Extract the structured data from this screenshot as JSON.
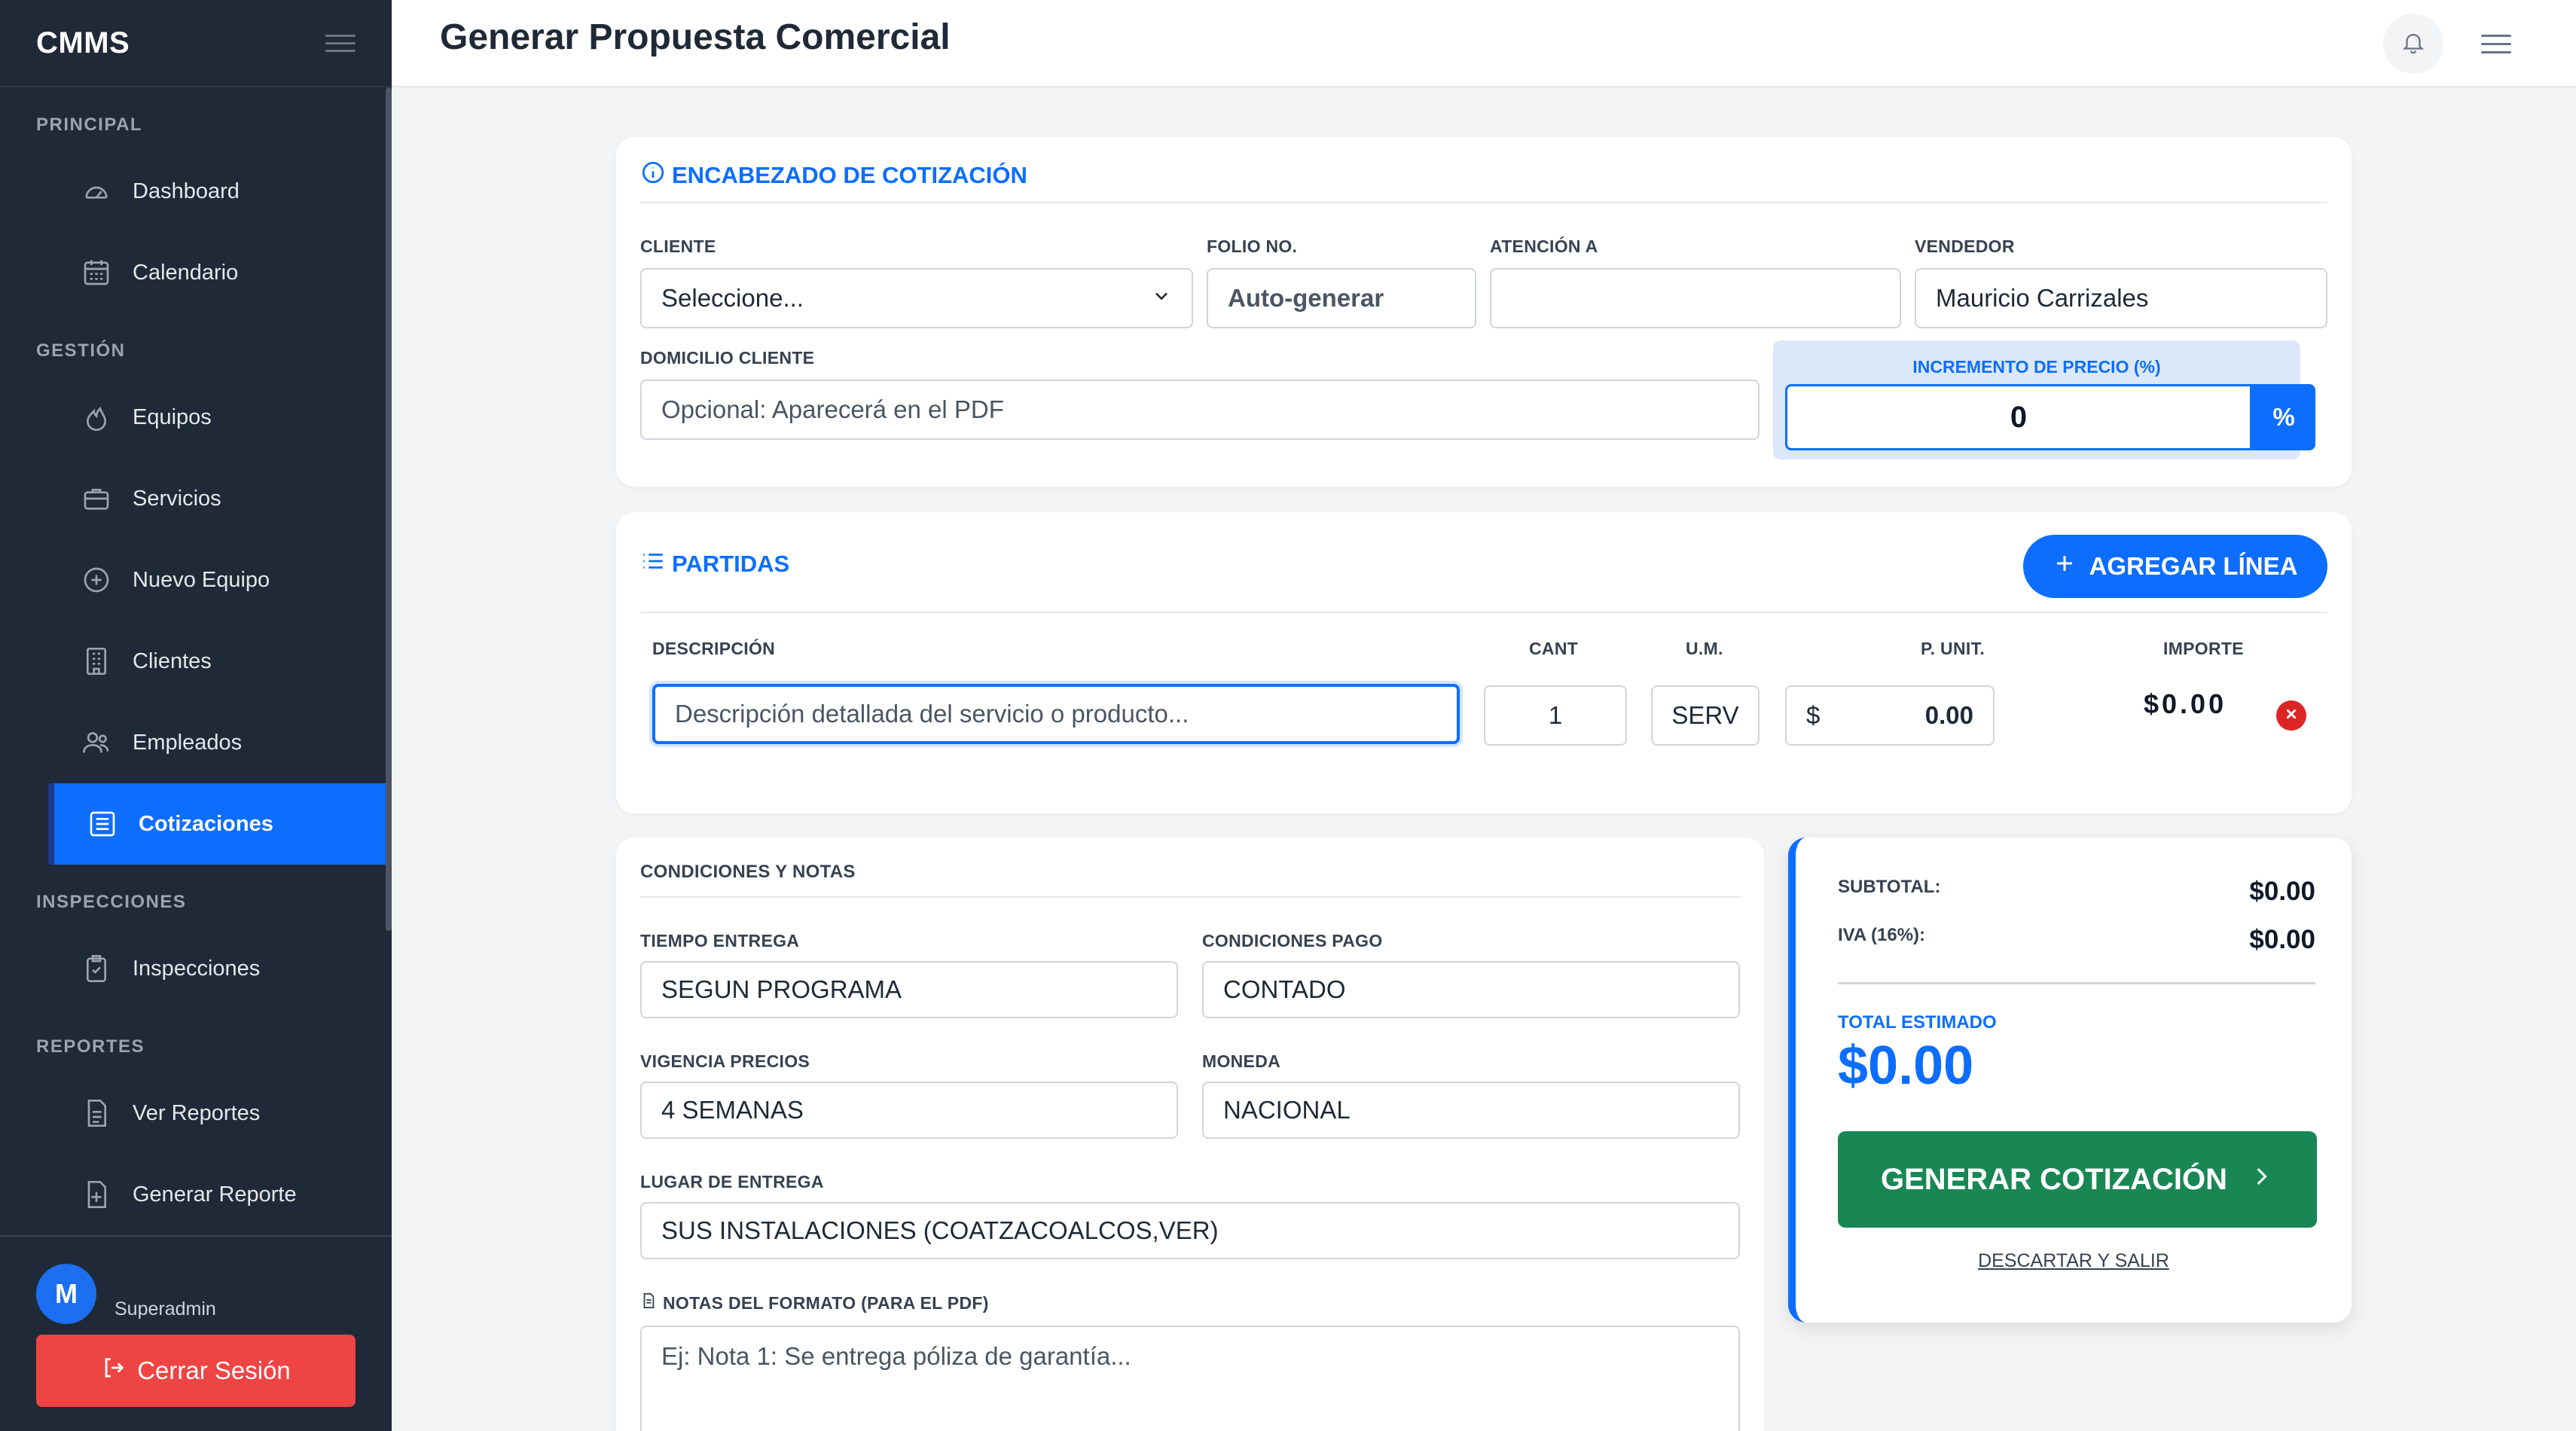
{
  "app": {
    "brand": "CMMS"
  },
  "sidebar": {
    "sections": {
      "principal": "PRINCIPAL",
      "gestion": "GESTIÓN",
      "inspecciones": "INSPECCIONES",
      "reportes": "REPORTES"
    },
    "items": {
      "dashboard": "Dashboard",
      "calendario": "Calendario",
      "equipos": "Equipos",
      "servicios": "Servicios",
      "nuevo_equipo": "Nuevo Equipo",
      "clientes": "Clientes",
      "empleados": "Empleados",
      "cotizaciones": "Cotizaciones",
      "inspecciones": "Inspecciones",
      "ver_reportes": "Ver Reportes",
      "generar_reporte": "Generar Reporte"
    },
    "active": "cotizaciones",
    "user": {
      "initial": "M",
      "role": "Superadmin"
    },
    "logout_label": "Cerrar Sesión"
  },
  "header": {
    "title": "Generar Propuesta Comercial"
  },
  "encabezado": {
    "title": "ENCABEZADO DE COTIZACIÓN",
    "cliente_label": "CLIENTE",
    "cliente_value": "Seleccione...",
    "folio_label": "FOLIO No.",
    "folio_placeholder": "Auto-generar",
    "atencion_label": "ATENCIÓN A",
    "atencion_value": "",
    "vendedor_label": "VENDEDOR",
    "vendedor_value": "Mauricio Carrizales",
    "domicilio_label": "DOMICILIO CLIENTE",
    "domicilio_placeholder": "Opcional: Aparecerá en el PDF",
    "incremento_label": "INCREMENTO DE PRECIO (%)",
    "incremento_value": "0",
    "incremento_suffix": "%"
  },
  "partidas": {
    "title": "PARTIDAS",
    "add_label": "AGREGAR LÍNEA",
    "columns": [
      "DESCRIPCIÓN",
      "CANT",
      "U.M.",
      "P. UNIT.",
      "IMPORTE"
    ],
    "rows": [
      {
        "descripcion_placeholder": "Descripción detallada del servicio o producto...",
        "cant": "1",
        "um": "SERV",
        "currency": "$",
        "p_unit": "0.00",
        "importe": "$0.00"
      }
    ]
  },
  "condiciones": {
    "title": "CONDICIONES Y NOTAS",
    "tiempo_label": "TIEMPO ENTREGA",
    "tiempo_value": "SEGUN PROGRAMA",
    "pago_label": "CONDICIONES PAGO",
    "pago_value": "CONTADO",
    "vigencia_label": "VIGENCIA PRECIOS",
    "vigencia_value": "4 SEMANAS",
    "moneda_label": "MONEDA",
    "moneda_value": "NACIONAL",
    "lugar_label": "LUGAR DE ENTREGA",
    "lugar_value": "SUS INSTALACIONES (COATZACOALCOS,VER)",
    "notas_label": "NOTAS DEL FORMATO (PARA EL PDF)",
    "notas_placeholder": "Ej: Nota 1: Se entrega póliza de garantía..."
  },
  "resumen": {
    "subtotal_label": "SUBTOTAL:",
    "subtotal_value": "$0.00",
    "iva_label": "IVA (16%):",
    "iva_value": "$0.00",
    "total_label": "TOTAL ESTIMADO",
    "total_value": "$0.00",
    "generate_label": "GENERAR COTIZACIÓN",
    "discard_label": "DESCARTAR Y SALIR"
  },
  "colors": {
    "sidebar_bg": "#1f2937",
    "accent": "#0d6efd",
    "success": "#198754",
    "danger": "#ef4444"
  }
}
